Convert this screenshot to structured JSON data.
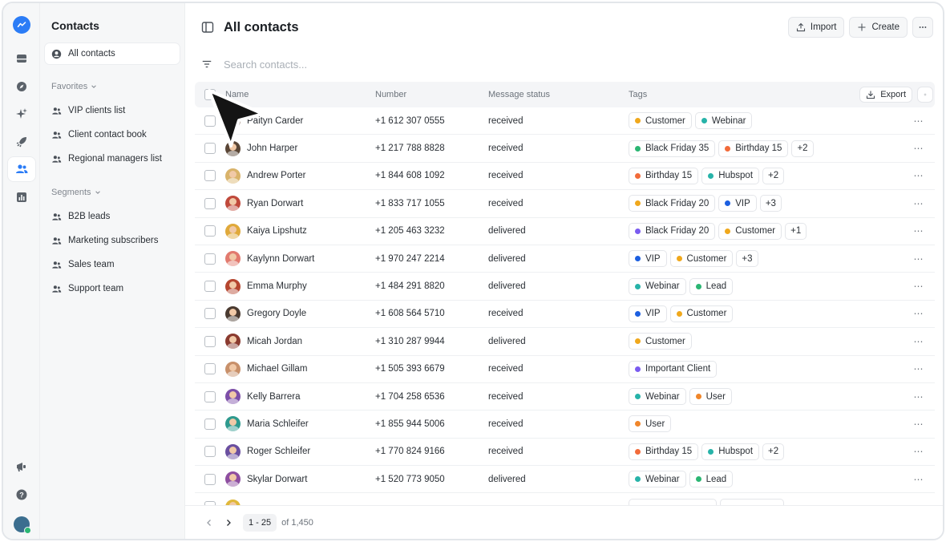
{
  "sidebar": {
    "title": "Contacts",
    "all_contacts": "All contacts",
    "favorites_label": "Favorites",
    "favorites": [
      "VIP clients list",
      "Client contact book",
      "Regional managers list"
    ],
    "segments_label": "Segments",
    "segments": [
      "B2B leads",
      "Marketing subscribers",
      "Sales team",
      "Support team"
    ]
  },
  "header": {
    "title": "All contacts",
    "import_label": "Import",
    "create_label": "Create"
  },
  "search": {
    "placeholder": "Search contacts..."
  },
  "table": {
    "columns": [
      "Name",
      "Number",
      "Message status",
      "Tags"
    ],
    "export_label": "Export",
    "rows": [
      {
        "name": "Paityn Carder",
        "number": "+1 612 307 0555",
        "status": "received",
        "tags": [
          {
            "label": "Customer",
            "color": "#f0a81c"
          },
          {
            "label": "Webinar",
            "color": "#27b3a9"
          }
        ],
        "more": "",
        "avatar": "#7a5a4a"
      },
      {
        "name": "John Harper",
        "number": "+1 217 788 8828",
        "status": "received",
        "tags": [
          {
            "label": "Black Friday 35",
            "color": "#2bb673"
          },
          {
            "label": "Birthday 15",
            "color": "#f26b3a"
          }
        ],
        "more": "+2",
        "avatar": "#5a4636"
      },
      {
        "name": "Andrew Porter",
        "number": "+1 844 608 1092",
        "status": "received",
        "tags": [
          {
            "label": "Birthday 15",
            "color": "#f26b3a"
          },
          {
            "label": "Hubspot",
            "color": "#27b3a9"
          }
        ],
        "more": "+2",
        "avatar": "#d9b36a"
      },
      {
        "name": "Ryan Dorwart",
        "number": "+1 833 717 1055",
        "status": "received",
        "tags": [
          {
            "label": "Black Friday 20",
            "color": "#f0a81c"
          },
          {
            "label": "VIP",
            "color": "#1c5fe0"
          }
        ],
        "more": "+3",
        "avatar": "#c0493b"
      },
      {
        "name": "Kaiya Lipshutz",
        "number": "+1 205 463 3232",
        "status": "delivered",
        "tags": [
          {
            "label": "Black Friday 20",
            "color": "#7a5cf0"
          },
          {
            "label": "Customer",
            "color": "#f0a81c"
          }
        ],
        "more": "+1",
        "avatar": "#e0a93a"
      },
      {
        "name": "Kaylynn Dorwart",
        "number": "+1 970 247 2214",
        "status": "delivered",
        "tags": [
          {
            "label": "VIP",
            "color": "#1c5fe0"
          },
          {
            "label": "Customer",
            "color": "#f0a81c"
          }
        ],
        "more": "+3",
        "avatar": "#e27a6e"
      },
      {
        "name": "Emma Murphy",
        "number": "+1 484 291 8820",
        "status": "delivered",
        "tags": [
          {
            "label": "Webinar",
            "color": "#27b3a9"
          },
          {
            "label": "Lead",
            "color": "#2bb673"
          }
        ],
        "more": "",
        "avatar": "#b5462f"
      },
      {
        "name": "Gregory Doyle",
        "number": "+1 608 564 5710",
        "status": "received",
        "tags": [
          {
            "label": "VIP",
            "color": "#1c5fe0"
          },
          {
            "label": "Customer",
            "color": "#f0a81c"
          }
        ],
        "more": "",
        "avatar": "#4a3a30"
      },
      {
        "name": "Micah Jordan",
        "number": "+1 310 287 9944",
        "status": "delivered",
        "tags": [
          {
            "label": "Customer",
            "color": "#f0a81c"
          }
        ],
        "more": "",
        "avatar": "#8a3a2f"
      },
      {
        "name": "Michael Gillam",
        "number": "+1 505 393 6679",
        "status": "received",
        "tags": [
          {
            "label": "Important Client",
            "color": "#7a5cf0"
          }
        ],
        "more": "",
        "avatar": "#c8906a"
      },
      {
        "name": "Kelly Barrera",
        "number": "+1 704 258 6536",
        "status": "received",
        "tags": [
          {
            "label": "Webinar",
            "color": "#27b3a9"
          },
          {
            "label": "User",
            "color": "#f0862a"
          }
        ],
        "more": "",
        "avatar": "#7d4fa8"
      },
      {
        "name": "Maria Schleifer",
        "number": "+1 855 944 5006",
        "status": "received",
        "tags": [
          {
            "label": "User",
            "color": "#f0862a"
          }
        ],
        "more": "",
        "avatar": "#2e9a8e"
      },
      {
        "name": "Roger Schleifer",
        "number": "+1 770 824 9166",
        "status": "received",
        "tags": [
          {
            "label": "Birthday 15",
            "color": "#f26b3a"
          },
          {
            "label": "Hubspot",
            "color": "#27b3a9"
          }
        ],
        "more": "+2",
        "avatar": "#6a4fa0"
      },
      {
        "name": "Skylar Dorwart",
        "number": "+1 520 773 9050",
        "status": "delivered",
        "tags": [
          {
            "label": "Webinar",
            "color": "#27b3a9"
          },
          {
            "label": "Lead",
            "color": "#2bb673"
          }
        ],
        "more": "",
        "avatar": "#8e4ea0"
      },
      {
        "name": "",
        "number": "",
        "status": "",
        "tags": [
          {
            "label": "",
            "color": "#f0a81c"
          },
          {
            "label": "",
            "color": "#27b3a9"
          }
        ],
        "more": "",
        "avatar": "#e0b83a"
      }
    ]
  },
  "pagination": {
    "range": "1 - 25",
    "total": "of 1,450"
  }
}
